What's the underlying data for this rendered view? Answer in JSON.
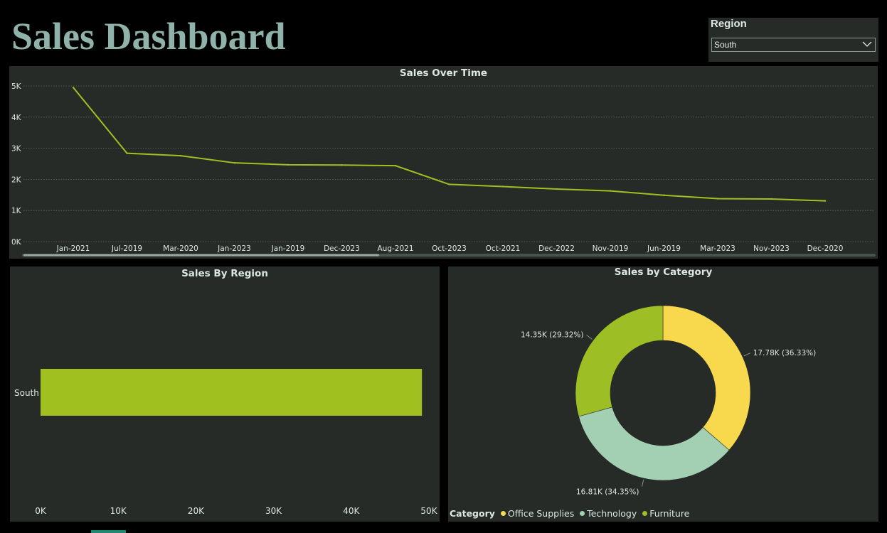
{
  "header": {
    "title": "Sales Dashboard"
  },
  "slicer": {
    "label": "Region",
    "value": "South",
    "chevron": "chevron-down-icon"
  },
  "colors": {
    "background": "#000000",
    "panel": "#262b27",
    "accent": "#a0c020",
    "office": "#f8d84c",
    "technology": "#a3cfb2",
    "furniture": "#9ebe25"
  },
  "chart_data": [
    {
      "type": "line",
      "title": "Sales Over Time",
      "x": [
        "Jan-2021",
        "Jul-2019",
        "Mar-2020",
        "Jan-2023",
        "Jan-2019",
        "Dec-2023",
        "Aug-2021",
        "Oct-2023",
        "Oct-2021",
        "Dec-2022",
        "Nov-2019",
        "Jun-2019",
        "Mar-2023",
        "Nov-2023",
        "Dec-2020"
      ],
      "series": [
        {
          "values": [
            4950,
            2840,
            2760,
            2530,
            2470,
            2460,
            2440,
            1840,
            1770,
            1690,
            1630,
            1490,
            1380,
            1370,
            1310
          ]
        }
      ],
      "ylim": [
        0,
        5000
      ],
      "yticks": [
        "0K",
        "1K",
        "2K",
        "3K",
        "4K",
        "5K"
      ],
      "grid": true
    },
    {
      "type": "bar",
      "orientation": "horizontal",
      "title": "Sales By Region",
      "categories": [
        "South"
      ],
      "values": [
        49100
      ],
      "xlim": [
        0,
        50000
      ],
      "xticks": [
        "0K",
        "10K",
        "20K",
        "30K",
        "40K",
        "50K"
      ]
    },
    {
      "type": "pie",
      "donut": true,
      "title": "Sales by Category",
      "legend_title": "Category",
      "legend_position": "bottom-left",
      "slices": [
        {
          "name": "Office Supplies",
          "value": 17780,
          "label": "17.78K (36.33%)",
          "color": "#f8d84c"
        },
        {
          "name": "Technology",
          "value": 16810,
          "label": "16.81K (34.35%)",
          "color": "#a3cfb2"
        },
        {
          "name": "Furniture",
          "value": 14350,
          "label": "14.35K (29.32%)",
          "color": "#9ebe25"
        }
      ]
    }
  ]
}
